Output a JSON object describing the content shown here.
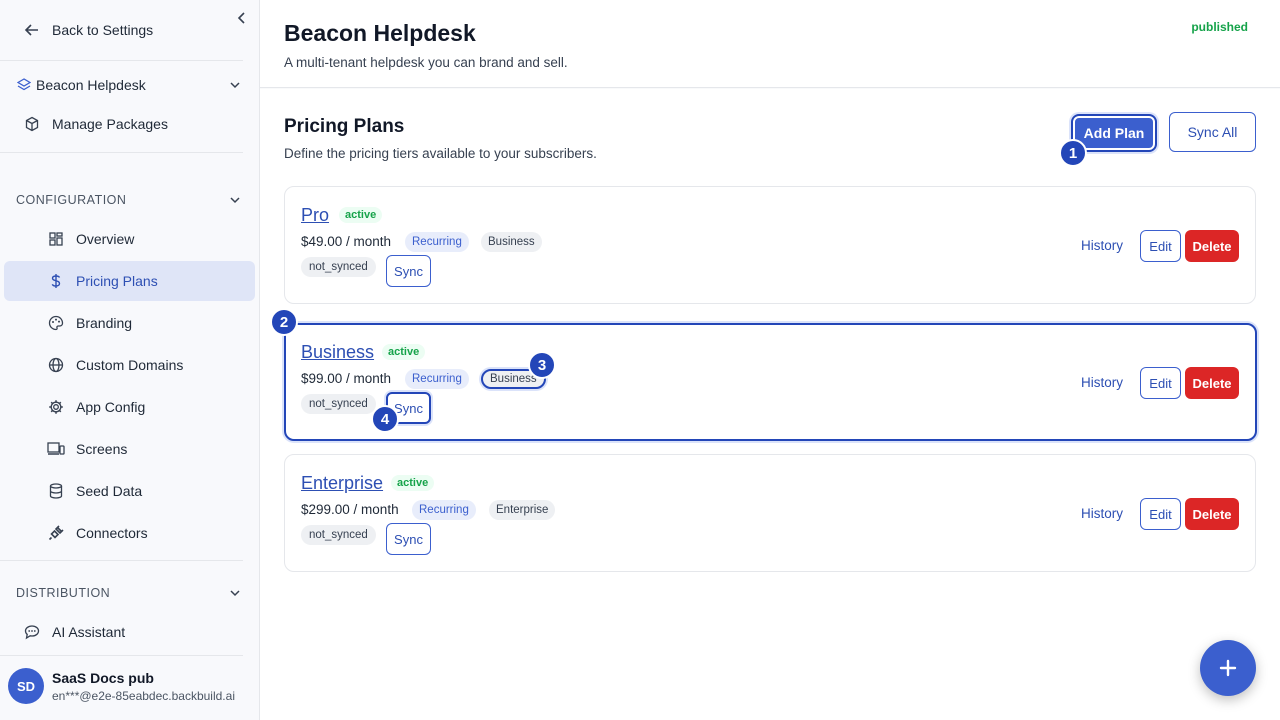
{
  "sidebar": {
    "back_label": "Back to Settings",
    "app_name": "Beacon Helpdesk",
    "manage_packages": "Manage Packages",
    "configuration_label": "CONFIGURATION",
    "nav": [
      {
        "label": "Overview",
        "icon": "grid-icon"
      },
      {
        "label": "Pricing Plans",
        "icon": "dollar-icon",
        "active": true
      },
      {
        "label": "Branding",
        "icon": "palette-icon"
      },
      {
        "label": "Custom Domains",
        "icon": "globe-icon"
      },
      {
        "label": "App Config",
        "icon": "gear-icon"
      },
      {
        "label": "Screens",
        "icon": "devices-icon"
      },
      {
        "label": "Seed Data",
        "icon": "database-icon"
      },
      {
        "label": "Connectors",
        "icon": "plug-icon"
      }
    ],
    "distribution_label": "DISTRIBUTION",
    "ai_assistant": "AI Assistant",
    "user": {
      "initials": "SD",
      "name": "SaaS Docs pub",
      "email": "en***@e2e-85eabdec.backbuild.ai"
    }
  },
  "header": {
    "title": "Beacon Helpdesk",
    "subtitle": "A multi-tenant helpdesk you can brand and sell.",
    "status": "published"
  },
  "pricing": {
    "title": "Pricing Plans",
    "subtitle": "Define the pricing tiers available to your subscribers.",
    "add_plan": "Add Plan",
    "sync_all": "Sync All",
    "plans": [
      {
        "name": "Pro",
        "status": "active",
        "price": "$49.00 / month",
        "billing": "Recurring",
        "tier": "Business",
        "sync_status": "not_synced",
        "sync": "Sync",
        "history": "History",
        "edit": "Edit",
        "delete": "Delete"
      },
      {
        "name": "Business",
        "status": "active",
        "price": "$99.00 / month",
        "billing": "Recurring",
        "tier": "Business",
        "sync_status": "not_synced",
        "sync": "Sync",
        "history": "History",
        "edit": "Edit",
        "delete": "Delete"
      },
      {
        "name": "Enterprise",
        "status": "active",
        "price": "$299.00 / month",
        "billing": "Recurring",
        "tier": "Enterprise",
        "sync_status": "not_synced",
        "sync": "Sync",
        "history": "History",
        "edit": "Edit",
        "delete": "Delete"
      }
    ]
  },
  "annotations": [
    "1",
    "2",
    "3",
    "4"
  ],
  "colors": {
    "accent": "#3b5fce",
    "active_nav_bg": "#dfe5f7",
    "danger": "#dc2626",
    "success": "#16a34a"
  }
}
